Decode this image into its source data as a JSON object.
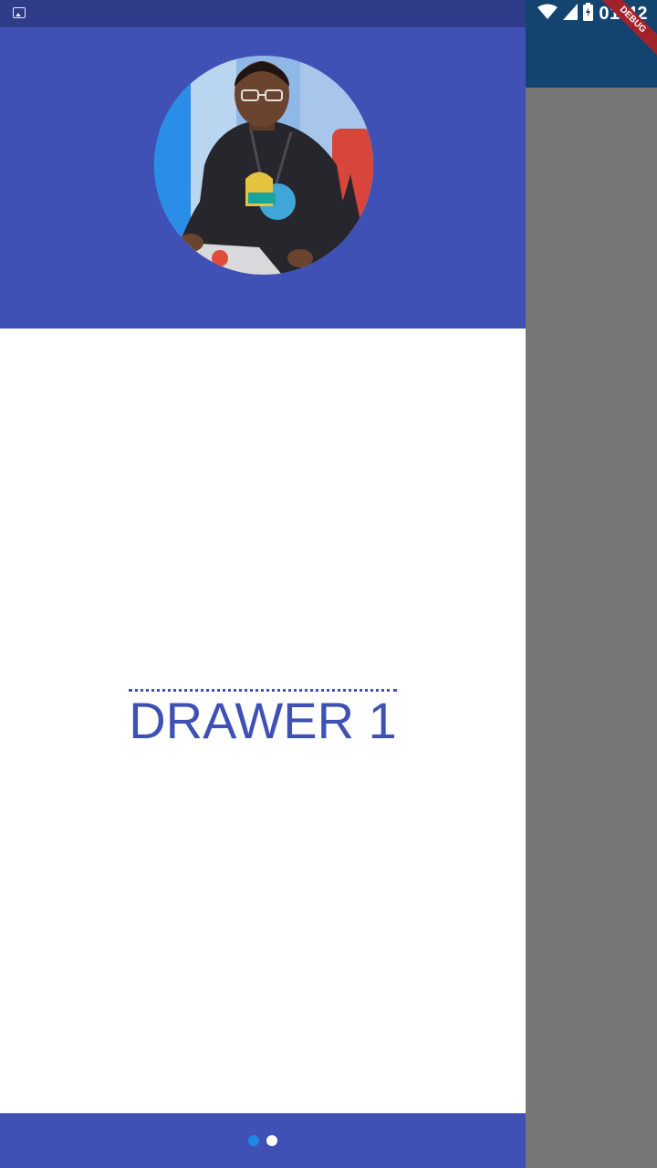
{
  "status_bar": {
    "time": "01:42",
    "left_icon": "image-notification-icon",
    "icons": [
      "wifi-icon",
      "cell-signal-icon",
      "battery-charging-icon"
    ]
  },
  "debug_banner": {
    "label": "DEBUG"
  },
  "drawer": {
    "title": "DRAWER 1",
    "avatar_icon": "profile-photo",
    "pager": {
      "page_count": 2,
      "active_index": 0
    }
  },
  "colors": {
    "primary": "#3f51b5",
    "status_bar": "#2f3c8a",
    "app_bar": "#134470",
    "scrim": "#767676",
    "active_dot": "#1e88e5",
    "inactive_dot": "#ffffff",
    "debug": "#a0222a"
  }
}
